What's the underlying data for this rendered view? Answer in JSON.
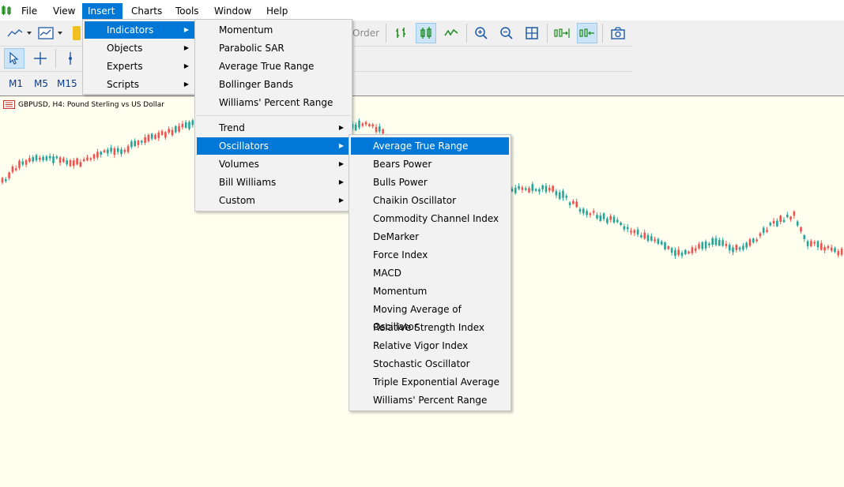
{
  "menubar": {
    "items": [
      "File",
      "View",
      "Insert",
      "Charts",
      "Tools",
      "Window",
      "Help"
    ]
  },
  "toolbar": {
    "order_label": "Order",
    "timeframes": [
      "M1",
      "M5",
      "M15"
    ]
  },
  "chart": {
    "title": "GBPUSD, H4:  Pound Sterling vs US Dollar",
    "colors": {
      "up": "#26a69a",
      "down": "#ef5350",
      "background": "#fffff0"
    }
  },
  "insert_menu": {
    "items": [
      "Indicators",
      "Objects",
      "Experts",
      "Scripts"
    ]
  },
  "indicators_menu": {
    "top_items": [
      "Momentum",
      "Parabolic SAR",
      "Average True Range",
      "Bollinger Bands",
      "Williams' Percent Range"
    ],
    "group_items": [
      "Trend",
      "Oscillators",
      "Volumes",
      "Bill Williams",
      "Custom"
    ]
  },
  "oscillators_menu": {
    "items": [
      "Average True Range",
      "Bears Power",
      "Bulls Power",
      "Chaikin Oscillator",
      "Commodity Channel Index",
      "DeMarker",
      "Force Index",
      "MACD",
      "Momentum",
      "Moving Average of Oscillator",
      "Relative Strength Index",
      "Relative Vigor Index",
      "Stochastic Oscillator",
      "Triple Exponential Average",
      "Williams' Percent Range"
    ]
  }
}
